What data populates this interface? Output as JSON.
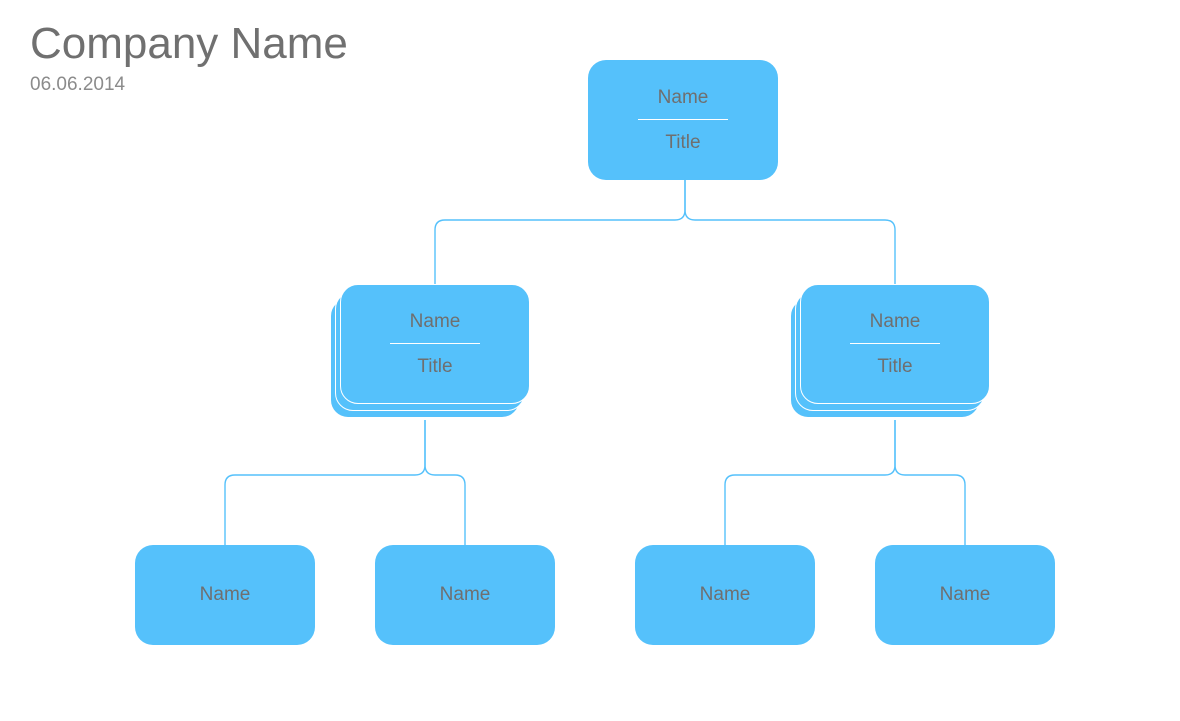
{
  "header": {
    "company_name": "Company Name",
    "date": "06.06.2014"
  },
  "colors": {
    "node_fill": "#55c1fb",
    "text": "#6f6f6f",
    "connector": "#55c1fb"
  },
  "org": {
    "root": {
      "name_label": "Name",
      "title_label": "Title"
    },
    "managers": [
      {
        "name_label": "Name",
        "title_label": "Title",
        "stacked": true
      },
      {
        "name_label": "Name",
        "title_label": "Title",
        "stacked": true
      }
    ],
    "leaves": [
      {
        "name_label": "Name"
      },
      {
        "name_label": "Name"
      },
      {
        "name_label": "Name"
      },
      {
        "name_label": "Name"
      }
    ]
  }
}
